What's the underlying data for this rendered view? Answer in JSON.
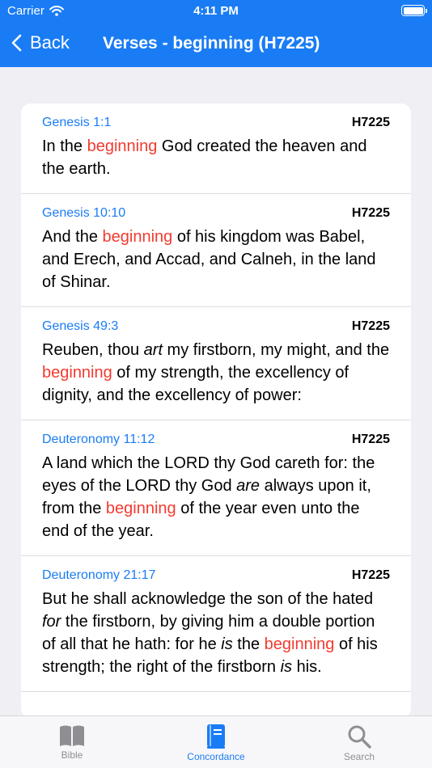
{
  "status_bar": {
    "carrier": "Carrier",
    "time": "4:11 PM"
  },
  "nav": {
    "back_label": "Back",
    "title": "Verses - beginning (H7225)"
  },
  "verses": [
    {
      "ref": "Genesis 1:1",
      "strong": "H7225",
      "parts": [
        {
          "t": "In the "
        },
        {
          "t": "beginning",
          "h": true
        },
        {
          "t": " God created the heaven and the earth."
        }
      ]
    },
    {
      "ref": "Genesis 10:10",
      "strong": "H7225",
      "parts": [
        {
          "t": "And the "
        },
        {
          "t": "beginning",
          "h": true
        },
        {
          "t": " of his kingdom was Babel, and Erech, and Accad, and Calneh, in the land of Shinar."
        }
      ]
    },
    {
      "ref": "Genesis 49:3",
      "strong": "H7225",
      "parts": [
        {
          "t": "Reuben, thou "
        },
        {
          "t": "art",
          "i": true
        },
        {
          "t": " my firstborn, my might, and the "
        },
        {
          "t": "beginning",
          "h": true
        },
        {
          "t": " of my strength, the excellency of dignity, and the excellency of power:"
        }
      ]
    },
    {
      "ref": "Deuteronomy 11:12",
      "strong": "H7225",
      "parts": [
        {
          "t": "A land which the LORD thy God careth for: the eyes of the LORD thy God "
        },
        {
          "t": "are",
          "i": true
        },
        {
          "t": " always upon it, from the "
        },
        {
          "t": "beginning",
          "h": true
        },
        {
          "t": " of the year even unto the end of the year."
        }
      ]
    },
    {
      "ref": "Deuteronomy 21:17",
      "strong": "H7225",
      "parts": [
        {
          "t": "But he shall acknowledge the son of the hated "
        },
        {
          "t": "for",
          "i": true
        },
        {
          "t": " the firstborn, by giving him a double portion of all that he hath: for he "
        },
        {
          "t": "is",
          "i": true
        },
        {
          "t": " the "
        },
        {
          "t": "beginning",
          "h": true
        },
        {
          "t": " of his strength; the right of the firstborn "
        },
        {
          "t": "is",
          "i": true
        },
        {
          "t": " his."
        }
      ]
    }
  ],
  "tabs": [
    {
      "label": "Bible",
      "icon": "book-open-icon",
      "active": false
    },
    {
      "label": "Concordance",
      "icon": "book-closed-icon",
      "active": true
    },
    {
      "label": "Search",
      "icon": "magnifier-icon",
      "active": false
    }
  ],
  "colors": {
    "accent": "#1a7cf4",
    "highlight": "#f23b30",
    "background": "#efeff4",
    "inactive_tab": "#8e8e93"
  }
}
